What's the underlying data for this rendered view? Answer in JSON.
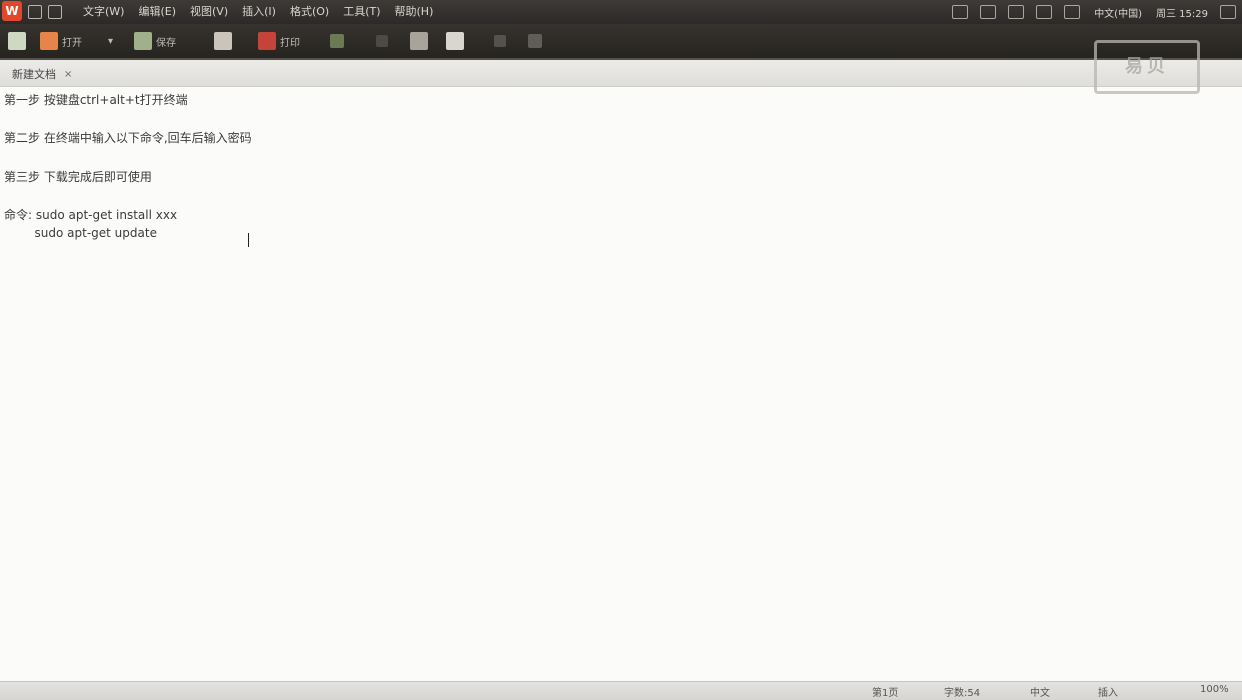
{
  "menubar": {
    "logo": "W",
    "items": [
      "文字(W)",
      "编辑(E)",
      "视图(V)",
      "插入(I)",
      "格式(O)",
      "工具(T)",
      "帮助(H)"
    ],
    "tray": {
      "lang": "中文(中国)",
      "time": "周三 15:29"
    }
  },
  "toolbar": {
    "new_label": "",
    "open_label": "打开",
    "save_label": "保存",
    "print_label": "打印"
  },
  "tab": {
    "title": "新建文档",
    "close": "×"
  },
  "watermark": "易贝",
  "editor": {
    "lines": [
      "第一步 按键盘ctrl+alt+t打开终端",
      "第二步 在终端中输入以下命令,回车后输入密码",
      "第三步 下载完成后即可使用",
      "命令: sudo apt-get install xxx",
      "        sudo apt-get update"
    ]
  },
  "status": {
    "page": "第1页",
    "words": "字数:54",
    "lang": "中文",
    "mode": "插入",
    "zoom": "100%"
  }
}
